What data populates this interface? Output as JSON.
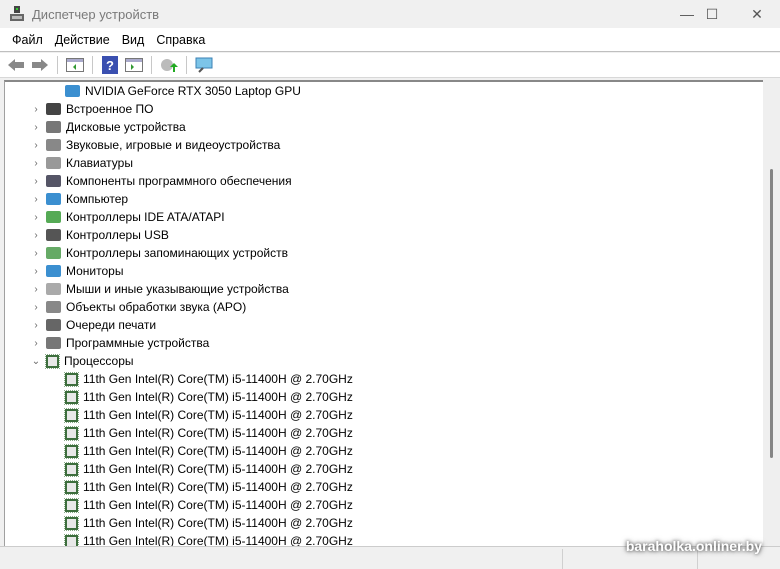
{
  "window": {
    "title": "Диспетчер устройств",
    "minimize": "—",
    "maximize": "☐",
    "close": "✕"
  },
  "menu": [
    {
      "label": "Файл"
    },
    {
      "label": "Действие"
    },
    {
      "label": "Вид"
    },
    {
      "label": "Справка"
    }
  ],
  "toolbar": [
    "back-icon",
    "forward-icon",
    "show-hide-console-tree-icon",
    "help-icon",
    "action-pane-icon",
    "update-driver-icon",
    "scan-hardware-icon"
  ],
  "tree": {
    "top_child": "NVIDIA GeForce RTX 3050 Laptop GPU",
    "categories": [
      {
        "label": "Встроенное ПО",
        "icon": "firmware-icon"
      },
      {
        "label": "Дисковые устройства",
        "icon": "disk-icon"
      },
      {
        "label": "Звуковые, игровые и видеоустройства",
        "icon": "speaker-icon"
      },
      {
        "label": "Клавиатуры",
        "icon": "keyboard-icon"
      },
      {
        "label": "Компоненты программного обеспечения",
        "icon": "software-component-icon"
      },
      {
        "label": "Компьютер",
        "icon": "computer-icon"
      },
      {
        "label": "Контроллеры IDE ATA/ATAPI",
        "icon": "ide-controller-icon"
      },
      {
        "label": "Контроллеры USB",
        "icon": "usb-icon"
      },
      {
        "label": "Контроллеры запоминающих устройств",
        "icon": "storage-controller-icon"
      },
      {
        "label": "Мониторы",
        "icon": "monitor-icon"
      },
      {
        "label": "Мыши и иные указывающие устройства",
        "icon": "mouse-icon"
      },
      {
        "label": "Объекты обработки звука (APO)",
        "icon": "audio-apo-icon"
      },
      {
        "label": "Очереди печати",
        "icon": "printer-icon"
      },
      {
        "label": "Программные устройства",
        "icon": "software-device-icon"
      },
      {
        "label": "Процессоры",
        "icon": "processor-icon",
        "expanded": true
      }
    ],
    "processors": [
      "11th Gen Intel(R) Core(TM) i5-11400H @ 2.70GHz",
      "11th Gen Intel(R) Core(TM) i5-11400H @ 2.70GHz",
      "11th Gen Intel(R) Core(TM) i5-11400H @ 2.70GHz",
      "11th Gen Intel(R) Core(TM) i5-11400H @ 2.70GHz",
      "11th Gen Intel(R) Core(TM) i5-11400H @ 2.70GHz",
      "11th Gen Intel(R) Core(TM) i5-11400H @ 2.70GHz",
      "11th Gen Intel(R) Core(TM) i5-11400H @ 2.70GHz",
      "11th Gen Intel(R) Core(TM) i5-11400H @ 2.70GHz",
      "11th Gen Intel(R) Core(TM) i5-11400H @ 2.70GHz",
      "11th Gen Intel(R) Core(TM) i5-11400H @ 2.70GHz"
    ]
  },
  "watermark": "baraholka.onliner.by"
}
